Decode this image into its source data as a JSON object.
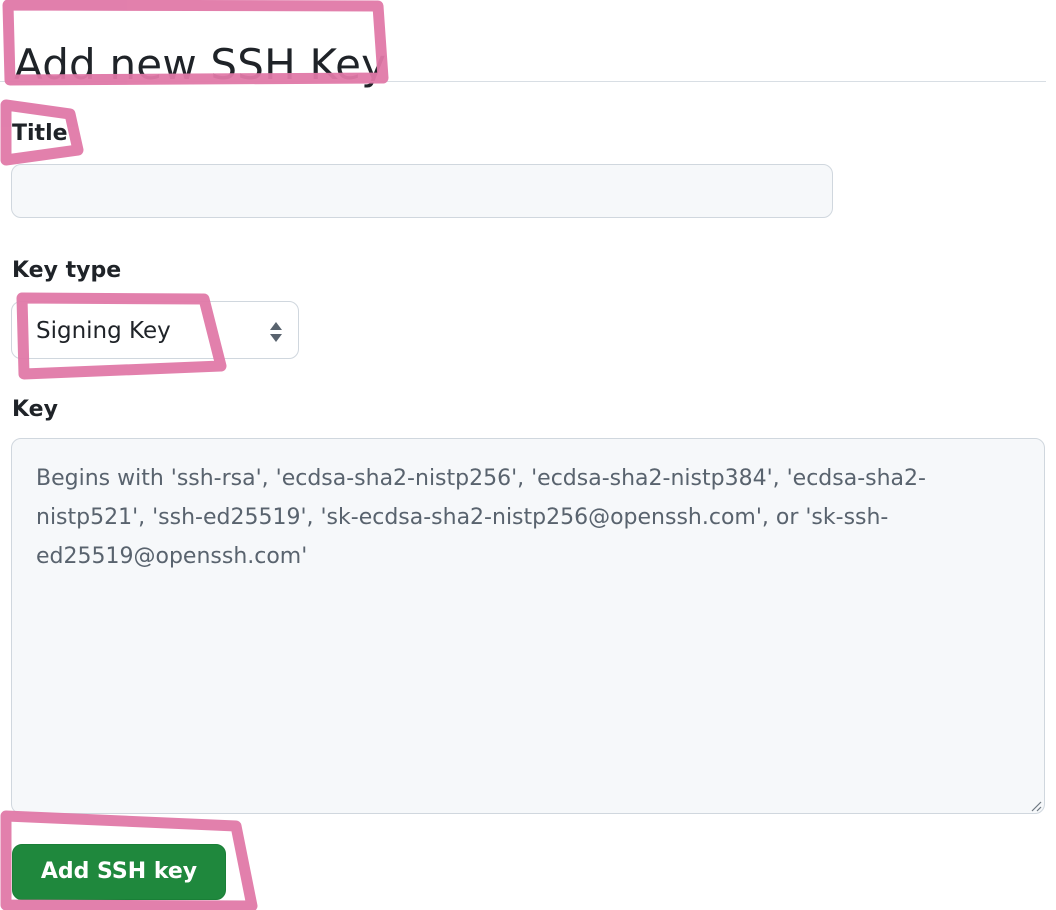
{
  "page": {
    "title": "Add new SSH Key"
  },
  "form": {
    "title_label": "Title",
    "title_value": "",
    "key_type_label": "Key type",
    "key_type_value": "Signing Key",
    "key_label": "Key",
    "key_value": "",
    "key_placeholder": "Begins with 'ssh-rsa', 'ecdsa-sha2-nistp256', 'ecdsa-sha2-nistp384', 'ecdsa-sha2-nistp521', 'ssh-ed25519', 'sk-ecdsa-sha2-nistp256@openssh.com', or 'sk-ssh-ed25519@openssh.com'",
    "submit_label": "Add SSH key"
  },
  "icons": {
    "select": "updown-arrows-icon",
    "resize": "resize-handle-icon"
  },
  "colors": {
    "primary_button": "#1f883d",
    "highlight": "#e079a8"
  }
}
